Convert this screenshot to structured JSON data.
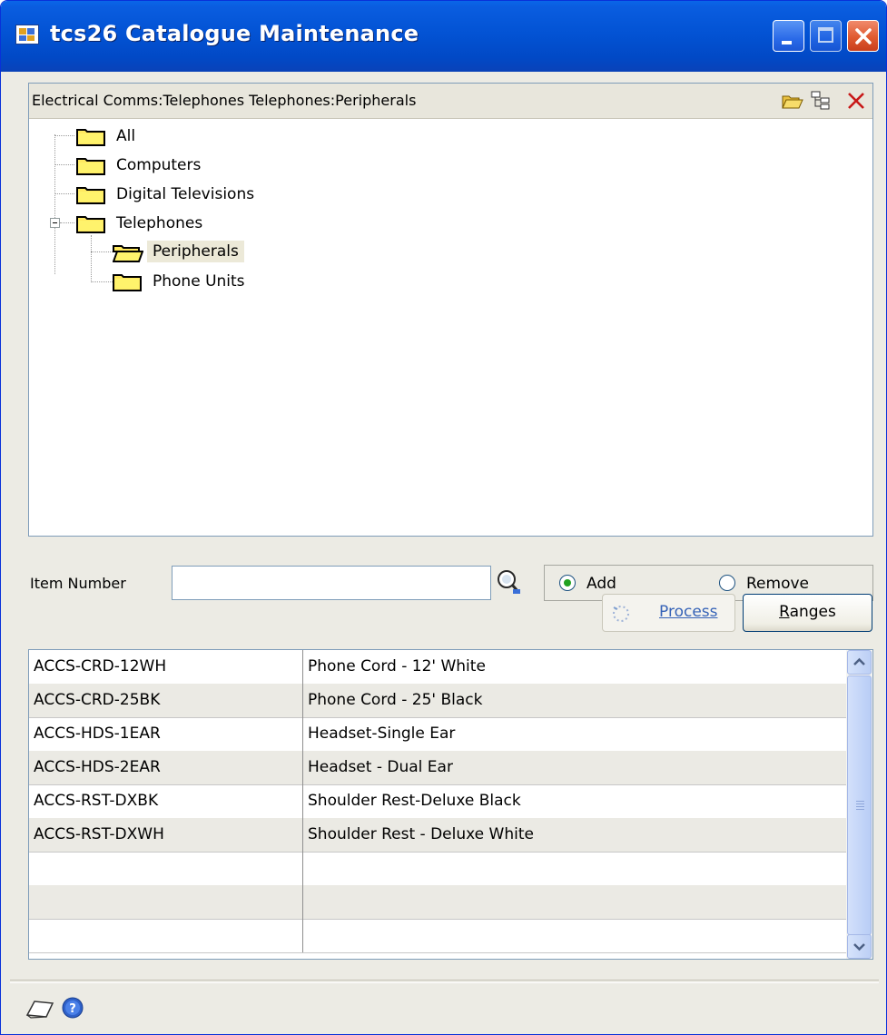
{
  "window": {
    "title": "tcs26 Catalogue Maintenance"
  },
  "tree": {
    "path_text": "Electrical Comms:Telephones  Telephones:Peripherals",
    "nodes": [
      {
        "label": "All"
      },
      {
        "label": "Computers"
      },
      {
        "label": "Digital Televisions"
      },
      {
        "label": "Telephones"
      },
      {
        "label": "Peripherals",
        "selected": true
      },
      {
        "label": "Phone Units"
      }
    ]
  },
  "item_number": {
    "label": "Item Number",
    "value": ""
  },
  "mode": {
    "add_label": "Add",
    "remove_label": "Remove",
    "selected": "Add"
  },
  "buttons": {
    "process_prefix": "",
    "process_underline": "P",
    "process_rest": "rocess",
    "ranges_underline": "R",
    "ranges_rest": "anges"
  },
  "grid": {
    "rows": [
      {
        "item": "ACCS-CRD-12WH",
        "description": "Phone Cord - 12' White"
      },
      {
        "item": "ACCS-CRD-25BK",
        "description": "Phone Cord - 25' Black"
      },
      {
        "item": "ACCS-HDS-1EAR",
        "description": "Headset-Single Ear"
      },
      {
        "item": "ACCS-HDS-2EAR",
        "description": "Headset - Dual Ear"
      },
      {
        "item": "ACCS-RST-DXBK",
        "description": "Shoulder Rest-Deluxe Black"
      },
      {
        "item": "ACCS-RST-DXWH",
        "description": "Shoulder Rest - Deluxe White"
      },
      {
        "item": "",
        "description": ""
      },
      {
        "item": "",
        "description": ""
      },
      {
        "item": "",
        "description": ""
      }
    ]
  },
  "colors": {
    "titlebar": "#0353d4",
    "window_bg": "#ecebe4",
    "selection_bg": "#ece9d8",
    "alt_row": "#ebeae4"
  },
  "icons": {
    "header": [
      "open-folder-icon",
      "tree-structure-icon",
      "delete-icon"
    ],
    "footer": [
      "note-icon",
      "help-icon"
    ]
  }
}
